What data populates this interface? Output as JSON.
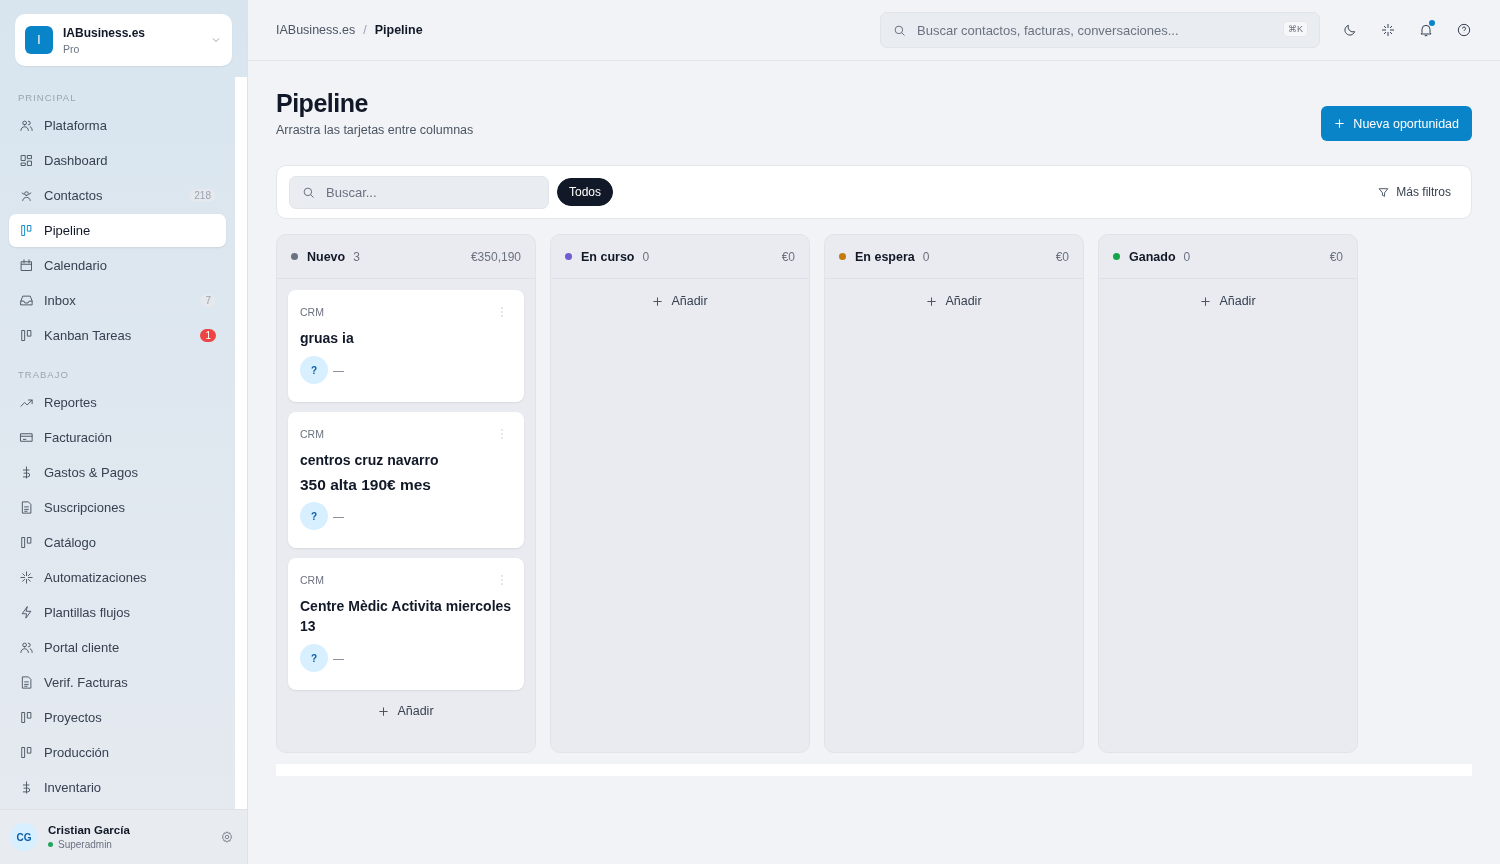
{
  "workspace": {
    "initial": "I",
    "name": "IABusiness.es",
    "plan": "Pro"
  },
  "sidebar": {
    "sections": [
      {
        "label": "PRINCIPAL",
        "items": [
          {
            "label": "Plataforma",
            "selected": false
          },
          {
            "label": "Dashboard",
            "selected": false
          },
          {
            "label": "Contactos",
            "selected": false,
            "badge": {
              "text": "218",
              "alert": false
            }
          },
          {
            "label": "Pipeline",
            "selected": true
          },
          {
            "label": "Calendario",
            "selected": false
          },
          {
            "label": "Inbox",
            "selected": false,
            "badge": {
              "text": "7",
              "alert": false
            }
          },
          {
            "label": "Kanban Tareas",
            "selected": false,
            "badge": {
              "text": "1",
              "alert": true
            }
          }
        ]
      },
      {
        "label": "TRABAJO",
        "items": [
          {
            "label": "Reportes",
            "selected": false
          },
          {
            "label": "Facturación",
            "selected": false
          },
          {
            "label": "Gastos & Pagos",
            "selected": false
          },
          {
            "label": "Suscripciones",
            "selected": false
          },
          {
            "label": "Catálogo",
            "selected": false
          },
          {
            "label": "Automatizaciones",
            "selected": false
          },
          {
            "label": "Plantillas flujos",
            "selected": false
          },
          {
            "label": "Portal cliente",
            "selected": false
          },
          {
            "label": "Verif. Facturas",
            "selected": false
          },
          {
            "label": "Proyectos",
            "selected": false
          },
          {
            "label": "Producción",
            "selected": false
          },
          {
            "label": "Inventario",
            "selected": false
          }
        ]
      }
    ]
  },
  "user": {
    "initials": "CG",
    "name": "Cristian García",
    "role": "Superadmin",
    "online": true
  },
  "breadcrumb": [
    "IABusiness.es",
    "Pipeline"
  ],
  "breadcrumb_separator": "/",
  "global_search": {
    "placeholder": "Buscar contactos, facturas, conversaciones...",
    "shortcut": "⌘K"
  },
  "notifications": {
    "unread": true
  },
  "page": {
    "title": "Pipeline",
    "subtitle": "Arrastra las tarjetas entre columnas",
    "primary_button": "Nueva oportunidad"
  },
  "filters": {
    "search_placeholder": "Buscar...",
    "chips": [
      {
        "label": "Todos",
        "selected": true
      }
    ],
    "more": "Más filtros"
  },
  "columns": [
    {
      "name": "Nuevo",
      "count": "3",
      "total": "€350,190",
      "color": "#6b7280",
      "cards": [
        {
          "tag": "CRM",
          "title": "gruas ia",
          "avatar": "?",
          "owner": "—"
        },
        {
          "tag": "CRM",
          "title": "centros cruz navarro",
          "value": "350 alta 190€ mes",
          "avatar": "?",
          "owner": "—"
        },
        {
          "tag": "CRM",
          "title": "Centre Mèdic Activita miercoles 13",
          "avatar": "?",
          "owner": "—"
        }
      ],
      "add": "Añadir"
    },
    {
      "name": "En curso",
      "count": "0",
      "total": "€0",
      "color": "#6b5fd3",
      "add": "Añadir"
    },
    {
      "name": "En espera",
      "count": "0",
      "total": "€0",
      "color": "#c27c0e",
      "add": "Añadir"
    },
    {
      "name": "Ganado",
      "count": "0",
      "total": "€0",
      "color": "#16a34a",
      "add": "Añadir"
    }
  ]
}
